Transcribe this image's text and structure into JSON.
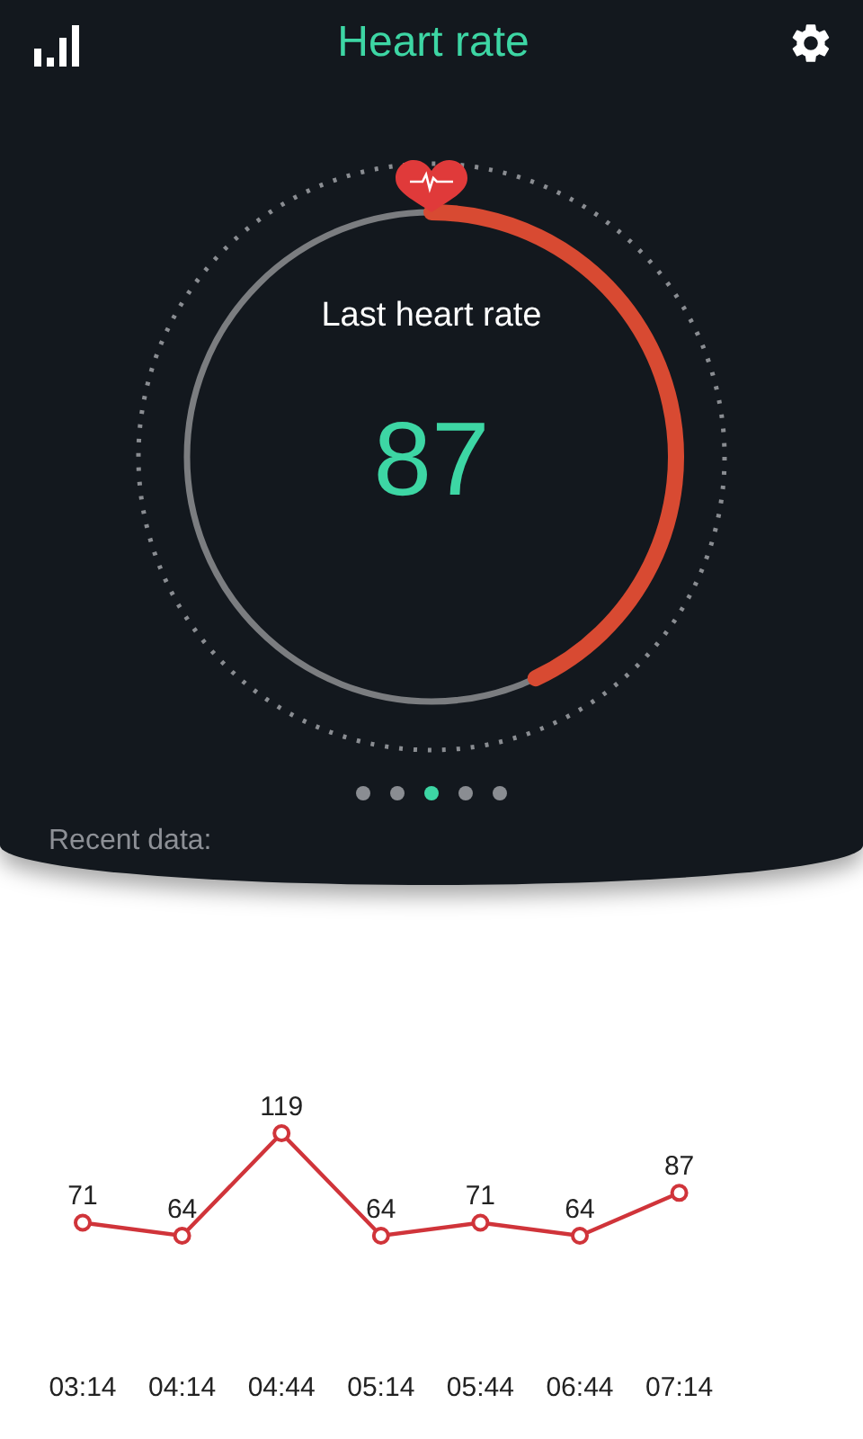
{
  "header": {
    "title": "Heart rate"
  },
  "gauge": {
    "label": "Last heart rate",
    "value": "87"
  },
  "pager": [
    {
      "selected": false
    },
    {
      "selected": false
    },
    {
      "selected": true
    },
    {
      "selected": false
    },
    {
      "selected": false
    }
  ],
  "recent_label": "Recent data:",
  "chart": {
    "chart_data": {
      "type": "line",
      "categories": [
        "03:14",
        "04:14",
        "04:44",
        "05:14",
        "05:44",
        "06:44",
        "07:14"
      ],
      "series": [
        {
          "color": "#d0343a",
          "marker": "circle",
          "values": [
            71,
            64,
            119,
            64,
            71,
            64,
            87
          ]
        }
      ],
      "data_labels": true
    }
  }
}
